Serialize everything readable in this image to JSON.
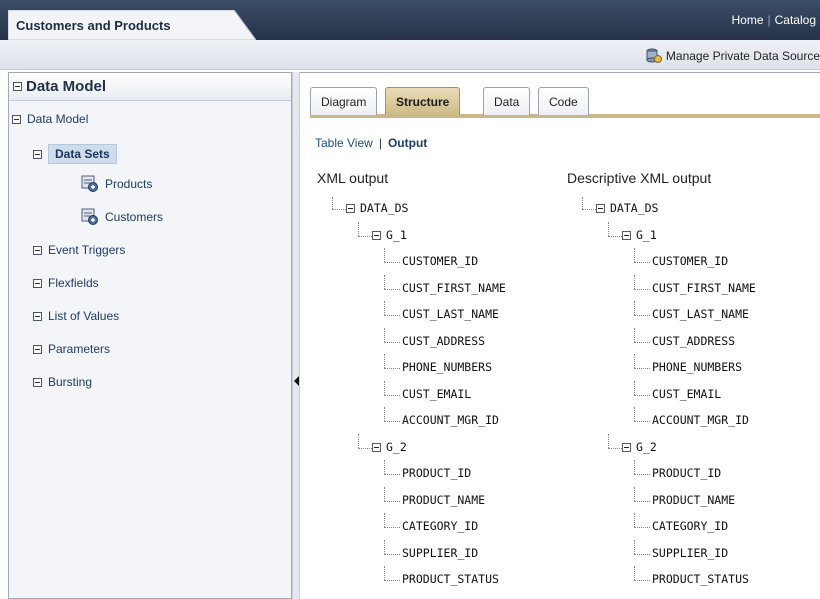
{
  "app": {
    "title": "Customers and Products"
  },
  "top_links": [
    "Home",
    "Catalog"
  ],
  "toolbar": {
    "manage_label": "Manage Private Data Source"
  },
  "left_panel": {
    "title": "Data Model",
    "root": "Data Model",
    "items": [
      {
        "label": "Data Sets",
        "selected": true,
        "children": [
          "Products",
          "Customers"
        ]
      },
      {
        "label": "Event Triggers"
      },
      {
        "label": "Flexfields"
      },
      {
        "label": "List of Values"
      },
      {
        "label": "Parameters"
      },
      {
        "label": "Bursting"
      }
    ]
  },
  "tabs": [
    {
      "label": "Diagram",
      "active": false
    },
    {
      "label": "Structure",
      "active": true
    },
    {
      "label": "Data",
      "active": false
    },
    {
      "label": "Code",
      "active": false
    }
  ],
  "view_links": {
    "table": "Table View",
    "output": "Output"
  },
  "columns": [
    {
      "title": "XML output"
    },
    {
      "title": "Descriptive XML output"
    }
  ],
  "xml_tree": {
    "root": "DATA_DS",
    "groups": [
      {
        "name": "G_1",
        "fields": [
          "CUSTOMER_ID",
          "CUST_FIRST_NAME",
          "CUST_LAST_NAME",
          "CUST_ADDRESS",
          "PHONE_NUMBERS",
          "CUST_EMAIL",
          "ACCOUNT_MGR_ID"
        ]
      },
      {
        "name": "G_2",
        "fields": [
          "PRODUCT_ID",
          "PRODUCT_NAME",
          "CATEGORY_ID",
          "SUPPLIER_ID",
          "PRODUCT_STATUS"
        ]
      }
    ]
  },
  "colors": {
    "header": "#263348",
    "tab_active": "#cdbb86",
    "link": "#1f4d87"
  }
}
